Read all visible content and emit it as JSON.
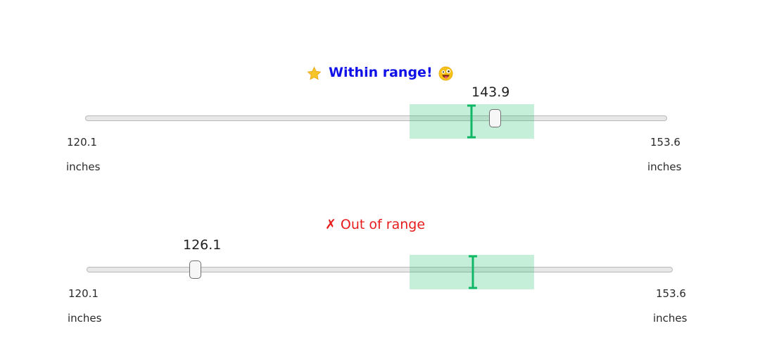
{
  "sliders": [
    {
      "status_text": "Within range!",
      "status_color": "#1010e8",
      "status_icon": "star-icon",
      "status_trailing_icon": "zany-face-icon",
      "value": "143.9",
      "min_value": "120.1",
      "min_unit": "inches",
      "max_value": "153.6",
      "max_unit": "inches",
      "target_zone_color": "#2ec478"
    },
    {
      "status_icon_glyph": "✗",
      "status_text": "Out of range",
      "status_color": "#e81c1c",
      "value": "126.1",
      "min_value": "120.1",
      "min_unit": "inches",
      "max_value": "153.6",
      "max_unit": "inches",
      "target_zone_color": "#2ec478"
    }
  ]
}
